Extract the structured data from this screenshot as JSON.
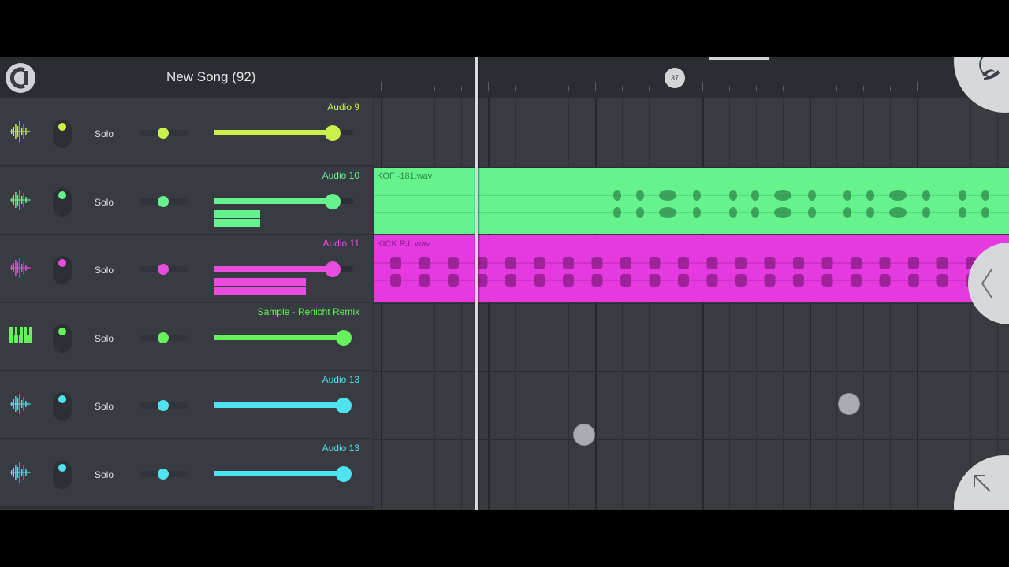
{
  "header": {
    "song_title": "New Song (92)",
    "position_marker": "37"
  },
  "tracks": [
    {
      "name": "Audio 9",
      "color": "#c9f04b",
      "icon": "waveform-icon",
      "solo_label": "Solo",
      "volume": 0.85,
      "has_clip": false
    },
    {
      "name": "Audio 10",
      "color": "#66f28d",
      "icon": "waveform-icon",
      "solo_label": "Solo",
      "volume": 0.85,
      "has_clip": true
    },
    {
      "name": "Audio 11",
      "color": "#e84de0",
      "icon": "waveform-icon",
      "solo_label": "Solo",
      "volume": 0.85,
      "has_clip": true
    },
    {
      "name": "Sample - Renicht Remix",
      "color": "#66f25a",
      "icon": "piano-keys-icon",
      "solo_label": "Solo",
      "volume": 1.0,
      "has_clip": false
    },
    {
      "name": "Audio 13",
      "color": "#4fe3ef",
      "icon": "waveform-icon",
      "solo_label": "Solo",
      "volume": 1.0,
      "has_clip": false
    },
    {
      "name": "Audio 13",
      "color": "#4fe3ef",
      "icon": "waveform-icon",
      "solo_label": "Solo",
      "volume": 1.0,
      "has_clip": false
    }
  ],
  "clips": [
    {
      "label": "KOF -181.wav",
      "color": "#66f28d",
      "label_color": "#2f8a4a",
      "track_index": 1
    },
    {
      "label": "KICK RJ .wav",
      "color": "#e53ae0",
      "label_color": "#8c1e88",
      "track_index": 2
    }
  ],
  "icons": {
    "menu": "fl-logo-icon",
    "corner": "fruit-logo-icon",
    "collapse": "chevron-left-icon",
    "expand": "arrow-up-left-icon"
  }
}
